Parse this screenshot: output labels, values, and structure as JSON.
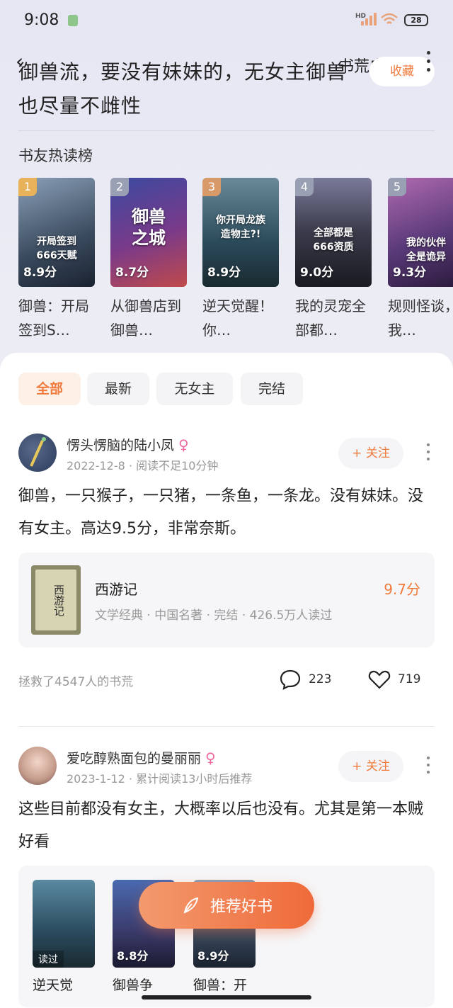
{
  "status_bar": {
    "time": "9:08",
    "hd": "HD",
    "battery": "28"
  },
  "header": {
    "breadcrumb_label": "书荒广场",
    "collect_label": "收藏",
    "back_glyph": "‹"
  },
  "topic": {
    "title": "御兽流，要没有妹妹的，无女主御兽也尽量不雌性"
  },
  "hot_list": {
    "title": "书友热读榜",
    "books": [
      {
        "rank": "1",
        "score": "8.9分",
        "name": "御兽：开局签到S…",
        "cover_text": "开局签到\n666天赋",
        "cover_color": "#4a5a6e",
        "rank_color": "#e7b25a"
      },
      {
        "rank": "2",
        "score": "8.7分",
        "name": "从御兽店到御兽…",
        "cover_text": "御兽\n之城",
        "cover_color": "#5a3a7a",
        "rank_color": "#9aa0b4"
      },
      {
        "rank": "3",
        "score": "8.9分",
        "name": "逆天觉醒！你…",
        "cover_text": "你开局龙族\n造物主?!",
        "cover_color": "#2a5a6e",
        "rank_color": "#d99a6a"
      },
      {
        "rank": "4",
        "score": "9.0分",
        "name": "我的灵宠全部都…",
        "cover_text": "全部都是\n666资质",
        "cover_color": "#3a3a4a",
        "rank_color": "#9aa0b4"
      },
      {
        "rank": "5",
        "score": "9.3分",
        "name": "规则怪谈，我…",
        "cover_text": "我的伙伴\n全是诡异",
        "cover_color": "#6a3a6a",
        "rank_color": "#9aa0b4"
      }
    ]
  },
  "filters": [
    {
      "label": "全部",
      "active": true
    },
    {
      "label": "最新",
      "active": false
    },
    {
      "label": "无女主",
      "active": false
    },
    {
      "label": "完结",
      "active": false
    }
  ],
  "posts": [
    {
      "username": "愣头愣脑的陆小凤",
      "gender": "♀",
      "meta": "2022-12-8 · 阅读不足10分钟",
      "follow_label": "+ 关注",
      "text": "御兽，一只猴子，一只猪，一条鱼，一条龙。没有妹妹。没有女主。高达9.5分，非常奈斯。",
      "book": {
        "title": "西游记",
        "score": "9.7分",
        "meta": "文学经典 · 中国名著 · 完结 · 426.5万人读过",
        "cover_text": "西游记"
      },
      "saved_text": "拯救了4547人的书荒",
      "comments": "223",
      "likes": "719"
    },
    {
      "username": "爱吃醇熟面包的曼丽丽",
      "gender": "♀",
      "meta": "2023-1-12 · 累计阅读13小时后推荐",
      "follow_label": "+ 关注",
      "text": "这些目前都没有女主，大概率以后也没有。尤其是第一本贼好看",
      "books": [
        {
          "name": "逆天觉",
          "badge": "读过",
          "score": "",
          "cover_color": "#2a5a6e"
        },
        {
          "name": "御兽争",
          "badge": "",
          "score": "8.8分",
          "cover_color": "#3a4a7a"
        },
        {
          "name": "御兽：开",
          "badge": "",
          "score": "8.9分",
          "cover_color": "#4a5a6e"
        }
      ]
    }
  ],
  "fab": {
    "label": "推荐好书"
  },
  "colors": {
    "accent": "#f07a3c",
    "female": "#ee6aa0"
  }
}
